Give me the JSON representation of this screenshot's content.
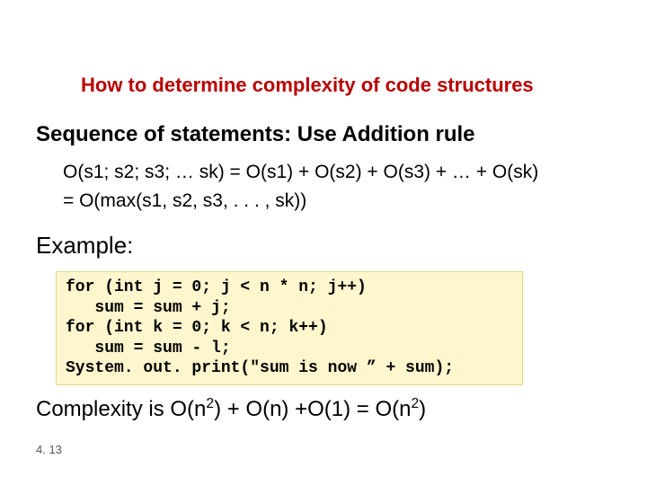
{
  "title": "How to determine complexity of code structures",
  "subhead": "Sequence of statements:  Use Addition rule",
  "formula_line1": "O(s1; s2; s3; … sk) = O(s1) + O(s2) + O(s3) + … + O(sk)",
  "formula_line2": "= O(max(s1, s2, s3, . . . , sk))",
  "example_label": "Example:",
  "code": "for (int j = 0; j < n * n; j++)\n   sum = sum + j;\nfor (int k = 0; k < n; k++)\n   sum = sum - l;\nSystem. out. print(\"sum is now ” + sum);",
  "complexity": {
    "prefix": "Complexity is O(n",
    "sup1": "2",
    "mid1": ") + O(n) +O(1) = O(n",
    "sup2": "2",
    "suffix": ")"
  },
  "page_number": "4. 13"
}
